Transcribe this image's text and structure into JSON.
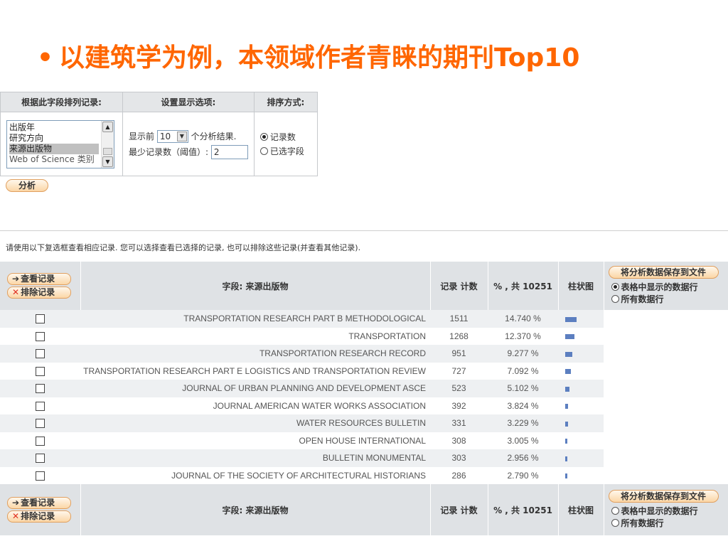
{
  "slide": {
    "bullet": "•",
    "title": "以建筑学为例，本领域作者青睐的期刊Top10"
  },
  "options": {
    "col_field": "根据此字段排列记录:",
    "col_display": "设置显示选项:",
    "col_sort": "排序方式:",
    "field_list": [
      "出版年",
      "研究方向",
      "来源出版物",
      "Web of Science 类别"
    ],
    "field_selected": "来源出版物",
    "display_prefix": "显示前",
    "display_count": "10",
    "display_suffix": "个分析结果.",
    "min_label": "最少记录数（阈值）:",
    "min_value": "2",
    "sort_record": "记录数",
    "sort_field": "已选字段",
    "sort_selected": "记录数"
  },
  "analyze_button": "分析",
  "instruction": "请使用以下复选框查看相应记录. 您可以选择查看已选择的记录, 也可以排除这些记录(并查看其他记录).",
  "table": {
    "view_records": "查看记录",
    "exclude_records": "排除记录",
    "field_header": "字段: 来源出版物",
    "count_header": "记录 计数",
    "pct_header": "% , 共 10251",
    "bar_header": "柱状图",
    "save_button": "将分析数据保存到文件",
    "save_option_rows": "表格中显示的数据行",
    "save_option_all": "所有数据行",
    "save_selected_top": "表格中显示的数据行",
    "save_selected_bottom": "",
    "max_count": 1511,
    "rows": [
      {
        "name": "TRANSPORTATION RESEARCH PART B METHODOLOGICAL",
        "count": "1511",
        "pct": "14.740 %",
        "value": 1511
      },
      {
        "name": "TRANSPORTATION",
        "count": "1268",
        "pct": "12.370 %",
        "value": 1268
      },
      {
        "name": "TRANSPORTATION RESEARCH RECORD",
        "count": "951",
        "pct": "9.277 %",
        "value": 951
      },
      {
        "name": "TRANSPORTATION RESEARCH PART E LOGISTICS AND TRANSPORTATION REVIEW",
        "count": "727",
        "pct": "7.092 %",
        "value": 727
      },
      {
        "name": "JOURNAL OF URBAN PLANNING AND DEVELOPMENT ASCE",
        "count": "523",
        "pct": "5.102 %",
        "value": 523
      },
      {
        "name": "JOURNAL AMERICAN WATER WORKS ASSOCIATION",
        "count": "392",
        "pct": "3.824 %",
        "value": 392
      },
      {
        "name": "WATER RESOURCES BULLETIN",
        "count": "331",
        "pct": "3.229 %",
        "value": 331
      },
      {
        "name": "OPEN HOUSE INTERNATIONAL",
        "count": "308",
        "pct": "3.005 %",
        "value": 308
      },
      {
        "name": "BULLETIN MONUMENTAL",
        "count": "303",
        "pct": "2.956 %",
        "value": 303
      },
      {
        "name": "JOURNAL OF THE SOCIETY OF ARCHITECTURAL HISTORIANS",
        "count": "286",
        "pct": "2.790 %",
        "value": 286
      }
    ]
  },
  "colors": {
    "title": "#ff6600",
    "bar": "#5c7fc0",
    "button_border": "#e0a060",
    "header_bg": "#dfe2e5"
  },
  "icons": {
    "arrow": "right-arrow-icon",
    "exclude": "x-icon",
    "scroll_up": "scroll-up-icon",
    "scroll_down": "scroll-down-icon",
    "dropdown": "dropdown-arrow-icon"
  }
}
